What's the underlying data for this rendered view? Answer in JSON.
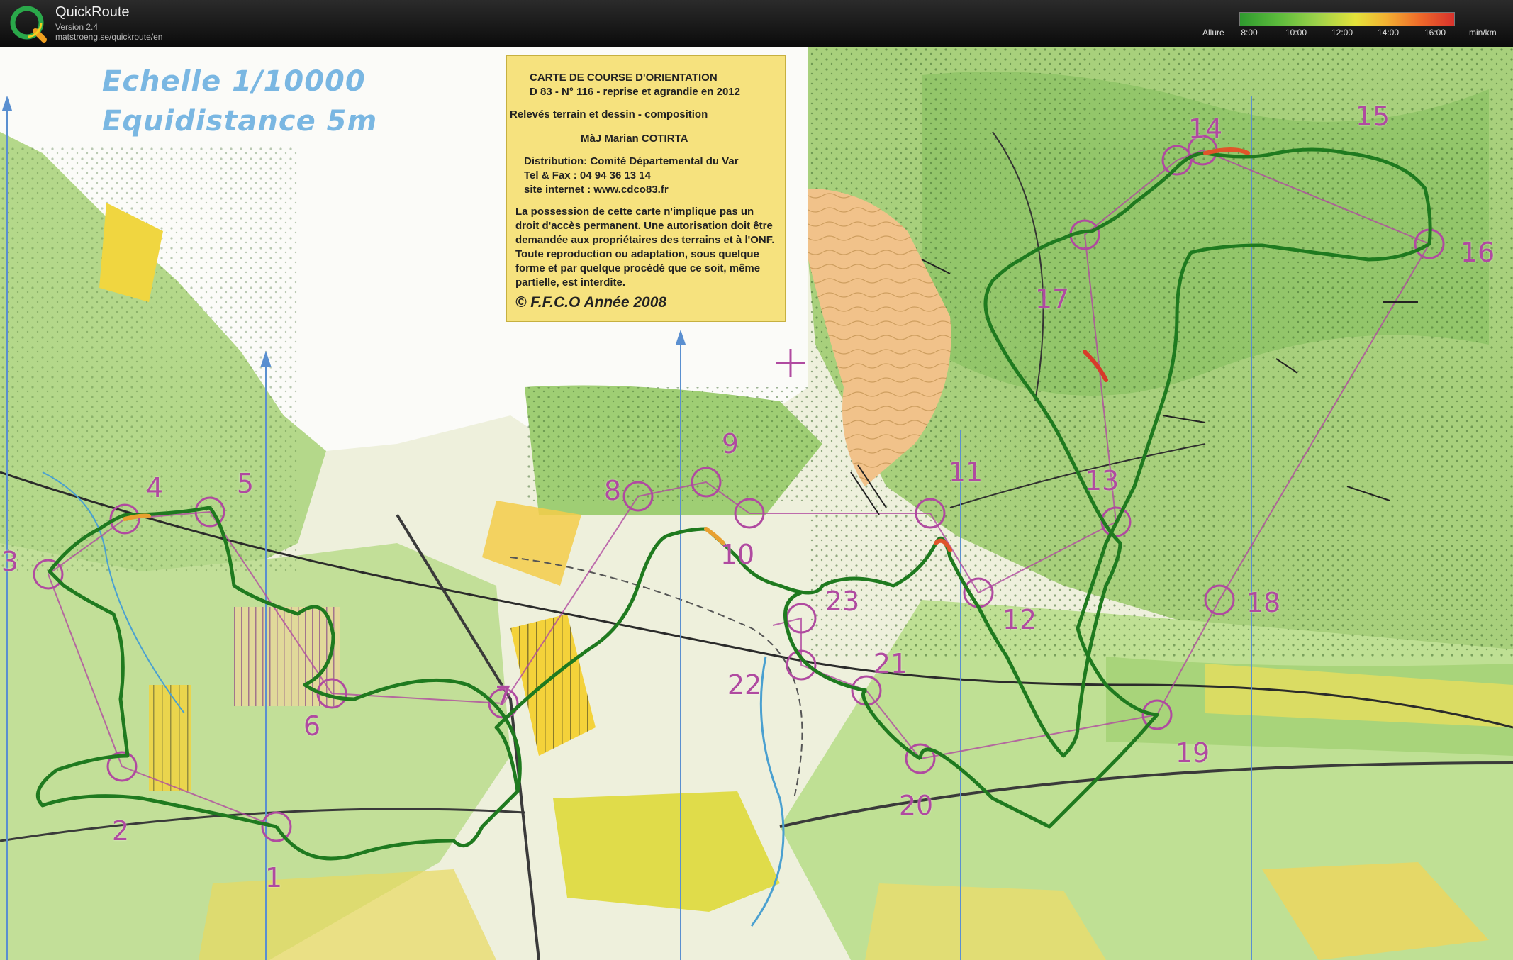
{
  "app": {
    "name": "QuickRoute",
    "version": "Version 2.4",
    "url": "matstroeng.se/quickroute/en"
  },
  "pace_legend": {
    "title": "Allure",
    "ticks": [
      "8:00",
      "10:00",
      "12:00",
      "14:00",
      "16:00"
    ],
    "unit": "min/km",
    "colors": [
      "#2f9a2f",
      "#9dd24a",
      "#e4e23a",
      "#ee6a2a",
      "#d8322c"
    ]
  },
  "map": {
    "scale_line1": "Echelle 1/10000",
    "scale_line2": "Equidistance 5m",
    "info": {
      "l1": "CARTE DE COURSE D'ORIENTATION",
      "l2": "D 83 - N° 116 - reprise et agrandie en 2012",
      "l3": "Relevés  terrain et dessin   -     composition",
      "l4": "MàJ  Marian COTIRTA",
      "l5": "Distribution:  Comité Départemental du Var",
      "l6": "Tel & Fax :  04 94 36 13 14",
      "l7": "site internet  : www.cdco83.fr",
      "note": "La possession de cette carte n'implique pas un droit d'accès permanent. Une autorisation doit être demandée aux propriétaires des terrains et à l'ONF. Toute reproduction ou adaptation, sous quelque forme et par quelque procédé que ce soit, même partielle, est interdite.",
      "copyright": "© F.F.C.O Année 2008"
    },
    "controls": [
      "1",
      "2",
      "3",
      "4",
      "5",
      "6",
      "7",
      "8",
      "9",
      "10",
      "11",
      "12",
      "13",
      "14",
      "15",
      "16",
      "17",
      "18",
      "19",
      "20",
      "21",
      "22",
      "23"
    ],
    "colors": {
      "route": "#1f7a1f",
      "controls": "#b04aa0",
      "forest": "#8cc464",
      "open": "#f2dc5a",
      "north_lines": "#5a8fd0"
    }
  }
}
